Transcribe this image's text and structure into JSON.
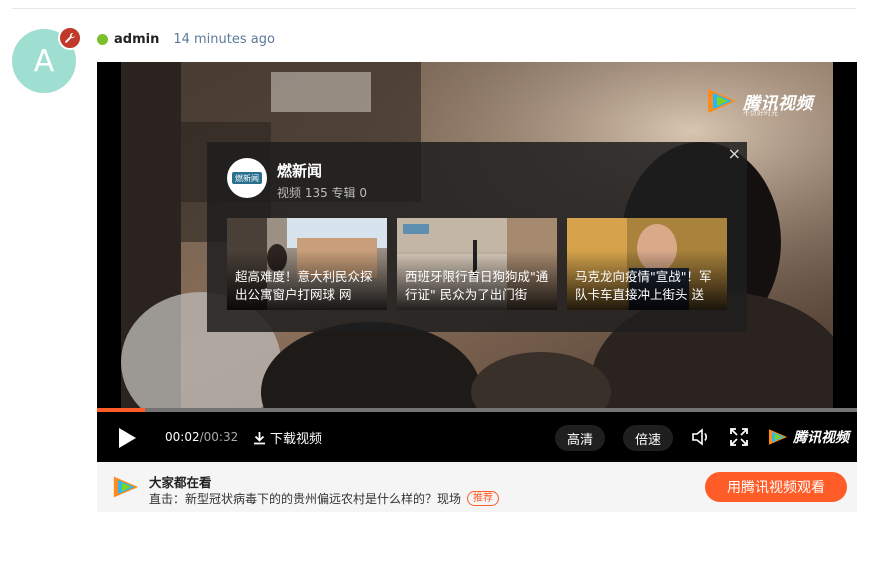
{
  "post": {
    "avatar_letter": "A",
    "username": "admin",
    "timestamp": "14 minutes ago"
  },
  "player": {
    "watermark_brand": "腾讯视频",
    "watermark_slogan": "不负好时光",
    "recommend": {
      "channel_name": "燃新闻",
      "channel_logo_text": "燃新闻",
      "stats": "视频 135 专辑 0",
      "close_label": "×",
      "cards": [
        {
          "caption": "超高难度！意大利民众探出公寓窗户打网球 网"
        },
        {
          "caption": "西班牙限行首日狗狗成\"通行证\" 民众为了出门街"
        },
        {
          "caption": "马克龙向疫情\"宣战\"！军队卡车直接冲上街头 送"
        }
      ]
    },
    "progress_fraction": 0.0625,
    "time_current": "00:02",
    "time_total": "/00:32",
    "download_label": "下载视频",
    "quality_label": "高清",
    "speed_label": "倍速",
    "brand_label": "腾讯视频"
  },
  "bottom_bar": {
    "title": "大家都在看",
    "headline": "直击：新型冠状病毒下的的贵州偏远农村是什么样的？现场",
    "tag": "推荐",
    "open_app_label": "用腾讯视频观看"
  },
  "colors": {
    "accent": "#ff5c27",
    "online": "#7cbf2a",
    "avatar_bg": "#9fdfd1",
    "admin_badge": "#c0392b",
    "time_text": "#5c7a99"
  }
}
